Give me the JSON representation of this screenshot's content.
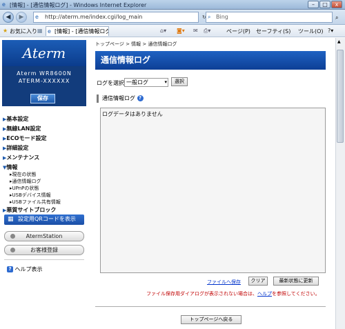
{
  "window": {
    "title": "[情報] - [通信情報ログ] - Windows Internet Explorer"
  },
  "address_bar": {
    "url": "http://aterm.me/index.cgi/log_main",
    "search_placeholder": "Bing"
  },
  "favorites_bar": {
    "favorites": "お気に入り",
    "tab": "[情報] - [通信情報ログ]",
    "page": "ページ(P)",
    "safety": "セーフティ(S)",
    "tools": "ツール(O)"
  },
  "sidebar": {
    "logo": "Aterm",
    "product_name": "Aterm WR8600N",
    "product_id": "ATERM-XXXXXX",
    "save_label": "保存",
    "menu": [
      "基本設定",
      "無線LAN設定",
      "ECOモード設定",
      "詳細設定",
      "メンテナンス",
      "情報"
    ],
    "info_items": [
      "現在の状態",
      "通信情報ログ",
      "UPnPの状態",
      "USBデバイス情報",
      "USBファイル共有情報"
    ],
    "block_label": "悪質サイトブロック",
    "qr_button": "設定用QRコードを表示",
    "atermstation_button": "AtermStation",
    "register_button": "お客様登録",
    "help_label": "ヘルプ表示"
  },
  "main": {
    "breadcrumb": "トップページ > 情報 > 通信情報ログ",
    "title": "通信情報ログ",
    "log_select_label": "ログを選択",
    "log_select_value": "一般ログ",
    "select_button": "選択",
    "section_title": "通信情報ログ",
    "log_text": "ログデータはありません",
    "save_file_link": "ファイルへ保存",
    "clear_button": "クリア",
    "refresh_button": "最新状態に更新",
    "warning_pre": "ファイル保存用ダイアログが表示されない場合は、",
    "warning_link": "ヘルプ",
    "warning_post": "を参照してください。",
    "top_page_button": "トップページへ戻る"
  }
}
